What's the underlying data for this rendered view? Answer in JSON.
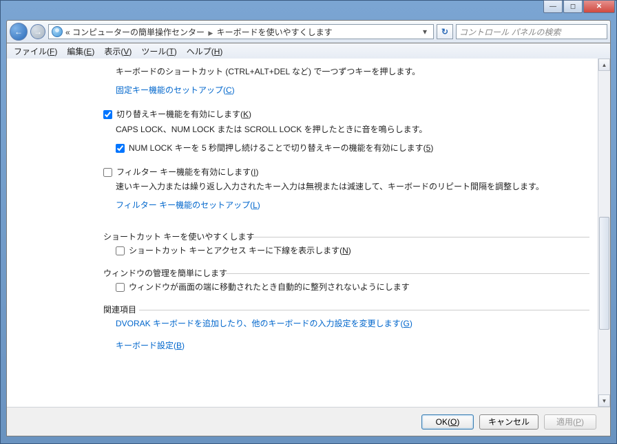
{
  "titlebar": {
    "minimize_glyph": "—",
    "maximize_glyph": "◻",
    "close_glyph": "✕"
  },
  "navbar": {
    "back_glyph": "←",
    "fwd_glyph": "→",
    "crumb_prefix": "«",
    "crumb1": "コンピューターの簡単操作センター",
    "crumb2": "キーボードを使いやすくします",
    "drop_glyph": "▾",
    "refresh_glyph": "↻",
    "search_placeholder": "コントロール パネルの検索"
  },
  "menubar": {
    "file": "ファイル(F)",
    "edit": "編集(E)",
    "view": "表示(V)",
    "tools": "ツール(T)",
    "help": "ヘルプ(H)"
  },
  "content": {
    "line1": "キーボードのショートカット (CTRL+ALT+DEL など) で一つずつキーを押します。",
    "link_sticky": "固定キー機能のセットアップ(C)",
    "chk_toggle": "切り替えキー機能を有効にします(K)",
    "toggle_desc": "CAPS LOCK、NUM LOCK または SCROLL LOCK を押したときに音を鳴らします。",
    "chk_numlock5": "NUM LOCK キーを 5 秒間押し続けることで切り替えキーの機能を有効にします(5)",
    "chk_filter": "フィルター キー機能を有効にします(I)",
    "filter_desc": "速いキー入力または繰り返し入力されたキー入力は無視または減速して、キーボードのリピート間隔を調整します。",
    "link_filter": "フィルター キー機能のセットアップ(L)",
    "legend_shortcut": "ショートカット キーを使いやすくします",
    "chk_underline": "ショートカット キーとアクセス キーに下線を表示します(N)",
    "legend_window": "ウィンドウの管理を簡単にします",
    "chk_nosnap": "ウィンドウが画面の端に移動されたとき自動的に整列されないようにします",
    "legend_related": "関連項目",
    "link_dvorak": "DVORAK キーボードを追加したり、他のキーボードの入力設定を変更します(G)",
    "link_kbsettings": "キーボード設定(B)"
  },
  "buttons": {
    "ok": "OK(O)",
    "cancel": "キャンセル",
    "apply": "適用(P)"
  },
  "checkbox_state": {
    "toggle": true,
    "numlock5": true,
    "filter": false,
    "underline": false,
    "nosnap": false
  }
}
